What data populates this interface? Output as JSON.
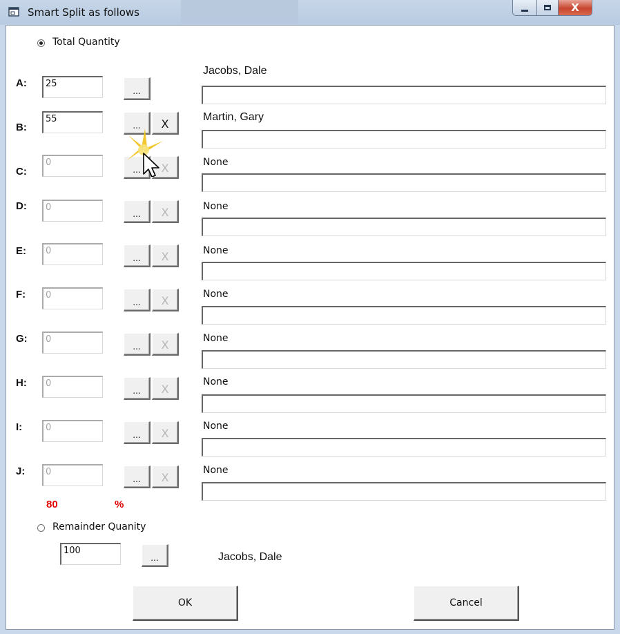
{
  "window": {
    "title": "Smart Split as follows",
    "close_glyph": "X"
  },
  "total_quantity_label": "Total Quantity",
  "rows": [
    {
      "label": "A:",
      "value": "25",
      "name": "Jacobs, Dale"
    },
    {
      "label": "B:",
      "value": "55",
      "name": "Martin, Gary"
    },
    {
      "label": "C:",
      "value": "0",
      "name": "None"
    },
    {
      "label": "D:",
      "value": "0",
      "name": "None"
    },
    {
      "label": "E:",
      "value": "0",
      "name": "None"
    },
    {
      "label": "F:",
      "value": "0",
      "name": "None"
    },
    {
      "label": "G:",
      "value": "0",
      "name": "None"
    },
    {
      "label": "H:",
      "value": "0",
      "name": "None"
    },
    {
      "label": "I:",
      "value": "0",
      "name": "None"
    },
    {
      "label": "J:",
      "value": "0",
      "name": "None"
    }
  ],
  "browse_label": "...",
  "clear_label": "X",
  "total_percent": "80",
  "percent_sign": "%",
  "remainder": {
    "label": "Remainder Quanity",
    "value": "100",
    "name": "Jacobs, Dale"
  },
  "ok_label": "OK",
  "cancel_label": "Cancel",
  "colors": {
    "total_text": "#e00000"
  }
}
